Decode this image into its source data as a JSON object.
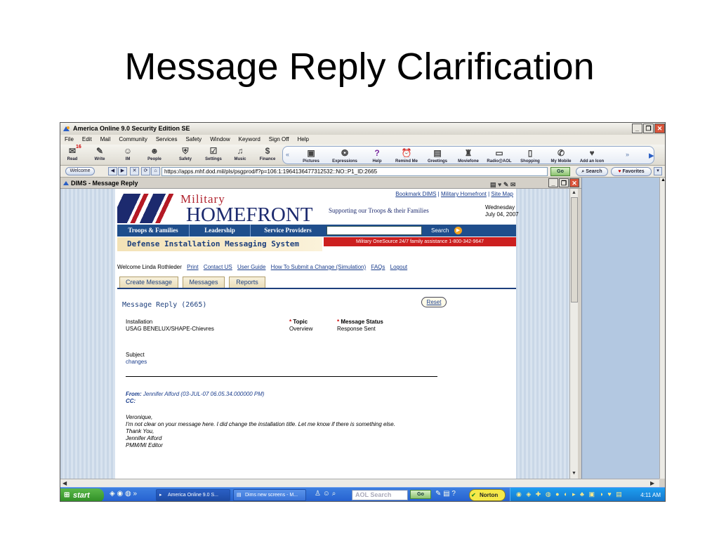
{
  "slide": {
    "title": "Message Reply Clarification"
  },
  "aol": {
    "title": "America Online 9.0 Security Edition SE",
    "menu": [
      "File",
      "Edit",
      "Mail",
      "Community",
      "Services",
      "Safety",
      "Window",
      "Keyword",
      "Sign Off",
      "Help"
    ],
    "toolbar_left": [
      {
        "label": "Read",
        "icon": "mailbox-icon"
      },
      {
        "label": "Write",
        "icon": "pencil-icon"
      },
      {
        "label": "IM",
        "icon": "person-icon"
      },
      {
        "label": "People",
        "icon": "people-icon"
      },
      {
        "label": "Safety",
        "icon": "shield-icon"
      },
      {
        "label": "Settings",
        "icon": "settings-icon"
      },
      {
        "label": "Music",
        "icon": "headphones-icon"
      },
      {
        "label": "Finance",
        "icon": "money-icon"
      }
    ],
    "mail_count": "16",
    "toolbar_right": [
      {
        "label": "Pictures",
        "icon": "camera-icon"
      },
      {
        "label": "Expressions",
        "icon": "swirl-icon"
      },
      {
        "label": "Help",
        "icon": "question-icon"
      },
      {
        "label": "Remind Me",
        "icon": "reminder-icon"
      },
      {
        "label": "Greetings",
        "icon": "card-icon"
      },
      {
        "label": "Moviefone",
        "icon": "popcorn-icon"
      },
      {
        "label": "Radio@AOL",
        "icon": "radio-icon"
      },
      {
        "label": "Shopping",
        "icon": "bag-icon"
      },
      {
        "label": "My Mobile",
        "icon": "phone-icon"
      },
      {
        "label": "Add an Icon",
        "icon": "add-icon"
      }
    ],
    "welcome_label": "Welcome",
    "url": "https://apps.mhf.dod.mil/pls/psgprod/f?p=106:1:196413647731253­2::NO::P1_ID:2665",
    "go_label": "Go",
    "search_label": "Search",
    "favorites_label": "Favorites"
  },
  "dims_window": {
    "title": "DIMS - Message Reply"
  },
  "site": {
    "top_links": [
      "Bookmark DIMS",
      "Military Homefront",
      "Site Map"
    ],
    "date": "Wednesday July 04, 2007",
    "logo_military": "Military",
    "logo_homefront": "HOMEFRONT",
    "tagline": "Supporting our Troops & their Families",
    "nav": [
      "Troops & Families",
      "Leadership",
      "Service Providers"
    ],
    "search_label": "Search",
    "dims_banner": "Defense Installation Messaging System",
    "mos_banner": "Military OneSource 24/7 family assistance 1-800-342-9647",
    "welcome_text": "Welcome Linda Rothleder",
    "welcome_links": [
      "Print",
      "Contact US",
      "User Guide",
      "How To Submit a Change (Simulation)",
      "FAQs",
      "Logout"
    ],
    "tabs": [
      "Create Message",
      "Messages",
      "Reports"
    ]
  },
  "reply": {
    "heading": "Message Reply (2665)",
    "reset_label": "Reset",
    "installation_label": "Installation",
    "installation_value": "USAG BENELUX/SHAPE-Chievres",
    "topic_label": "Topic",
    "topic_value": "Overview",
    "status_label": "Message Status",
    "status_value": "Response Sent",
    "subject_label": "Subject",
    "subject_value": "changes",
    "from_label": "From:",
    "from_value": "Jennifer Alford (03-JUL-07 06.05.34.000000 PM)",
    "cc_label": "CC:",
    "body": [
      "Veronique,",
      "I'm not clear on your message here. I did change the installation title. Let me know if there is something else.",
      "Thank You,",
      "Jennifer Alford",
      "PMM/MI Editor"
    ]
  },
  "taskbar": {
    "start_label": "start",
    "tasks": [
      "America Online 9.0 S...",
      "Dims new screens - M..."
    ],
    "aol_search": "AOL Search",
    "go_label": "Go",
    "norton_label": "Norton",
    "clock": "4:11 AM"
  }
}
